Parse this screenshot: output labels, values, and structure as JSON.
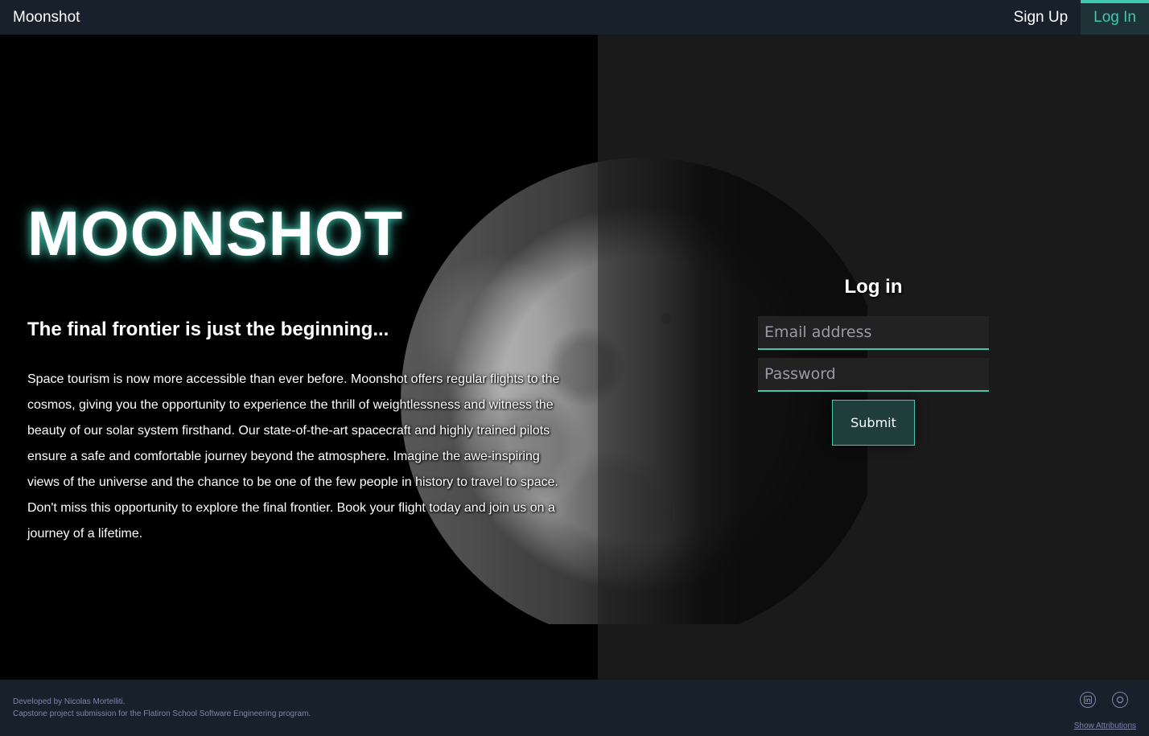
{
  "nav": {
    "brand": "Moonshot",
    "signup_label": "Sign Up",
    "login_label": "Log In"
  },
  "hero": {
    "title": "MOONSHOT",
    "subtitle": "The final frontier is just the beginning...",
    "body": "Space tourism is now more accessible than ever before. Moonshot offers regular flights to the cosmos, giving you the opportunity to experience the thrill of weightlessness and witness the beauty of our solar system firsthand. Our state-of-the-art spacecraft and highly trained pilots ensure a safe and comfortable journey beyond the atmosphere. Imagine the awe-inspiring views of the universe and the chance to be one of the few people in history to travel to space. Don't miss this opportunity to explore the final frontier. Book your flight today and join us on a journey of a lifetime."
  },
  "login": {
    "title": "Log in",
    "email_placeholder": "Email address",
    "password_placeholder": "Password",
    "submit_label": "Submit"
  },
  "footer": {
    "developer": "Developed by Nicolas Mortelliti.",
    "description": "Capstone project submission for the Flatiron School Software Engineering program.",
    "attributions_label": "Show Attributions",
    "icons": [
      "linkedin-icon",
      "github-icon"
    ]
  },
  "colors": {
    "accent": "#40c8b0",
    "nav_bg": "#17202b",
    "right_pane_bg": "#1a1a1a"
  }
}
